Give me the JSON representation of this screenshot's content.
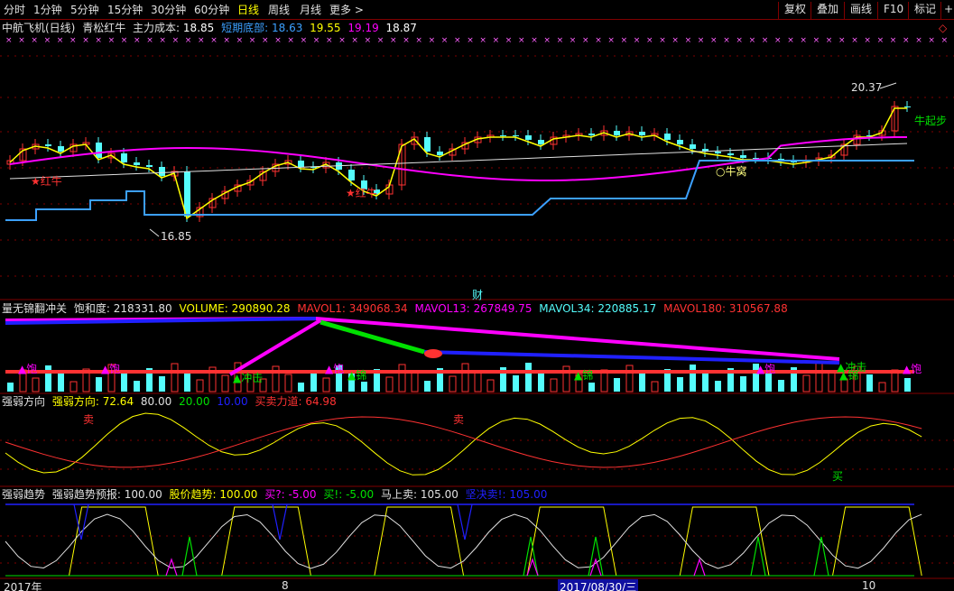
{
  "toolbar": {
    "periods": [
      "分时",
      "1分钟",
      "5分钟",
      "15分钟",
      "30分钟",
      "60分钟",
      "日线",
      "周线",
      "月线",
      "更多 >"
    ],
    "active_period_index": 6,
    "tools": [
      "复权",
      "叠加",
      "画线",
      "F10",
      "标记"
    ],
    "right_glyph": "+",
    "colors": {
      "active": "#ffff00",
      "text": "#e0e0e0",
      "border": "#800000"
    }
  },
  "main_panel": {
    "stock": "中航飞机(日线)",
    "indicator": "青松红牛",
    "cost_label": "主力成本:",
    "cost_value": "18.85",
    "bottom_label": "短期底部:",
    "bottom_value": "18.63",
    "v2": "19.55",
    "v3": "19.19",
    "v4": "18.87",
    "corner_glyph": "◇",
    "high_label": "20.37",
    "low_label": "16.85",
    "hongniu": "★红牛",
    "niuwo": "○牛窝",
    "niuqibu": "牛起步",
    "cai_label": "财"
  },
  "vol_panel": {
    "title": "量无锦翻冲关",
    "sat_label": "饱和度:",
    "sat_value": "218331.80",
    "volume_label": "VOLUME:",
    "volume_value": "290890.28",
    "ma1_label": "MAVOL1:",
    "ma1_value": "349068.34",
    "ma13_label": "MAVOL13:",
    "ma13_value": "267849.75",
    "ma34_label": "MAVOL34:",
    "ma34_value": "220885.17",
    "ma180_label": "MAVOL180:",
    "ma180_value": "310567.88",
    "bao": "▲饱",
    "chongji": "▲冲击",
    "jin": "▲锦"
  },
  "dir_panel": {
    "title": "强弱方向",
    "dir_label": "强弱方向:",
    "dir_value": "72.64",
    "v80": "80.00",
    "v20": "20.00",
    "v10": "10.00",
    "sell_label": "买卖力道:",
    "sell_value": "64.98",
    "mai_sell": "卖",
    "mai_buy": "买"
  },
  "trend_panel": {
    "title": "强弱趋势",
    "forecast_label": "强弱趋势预报:",
    "forecast_value": "100.00",
    "price_label": "股价趋势:",
    "price_value": "100.00",
    "buyq_label": "买?:",
    "buyq_value": "-5.00",
    "buyx_label": "买!:",
    "buyx_value": "-5.00",
    "msell_label": "马上卖:",
    "msell_value": "105.00",
    "firm_label": "坚决卖!:",
    "firm_value": "105.00"
  },
  "axis": {
    "year_label": "2017年",
    "month8": "8",
    "cursor_date": "2017/08/30/三",
    "month10": "10"
  },
  "colors": {
    "cyan": "#54fcfc",
    "red": "#ff3232",
    "yellow": "#ffff00",
    "magenta": "#ff00ff",
    "white": "#ffffff",
    "blue": "#2020ff",
    "green": "#00e000",
    "lightblue": "#3ca0ff",
    "grid": "#800000"
  }
}
